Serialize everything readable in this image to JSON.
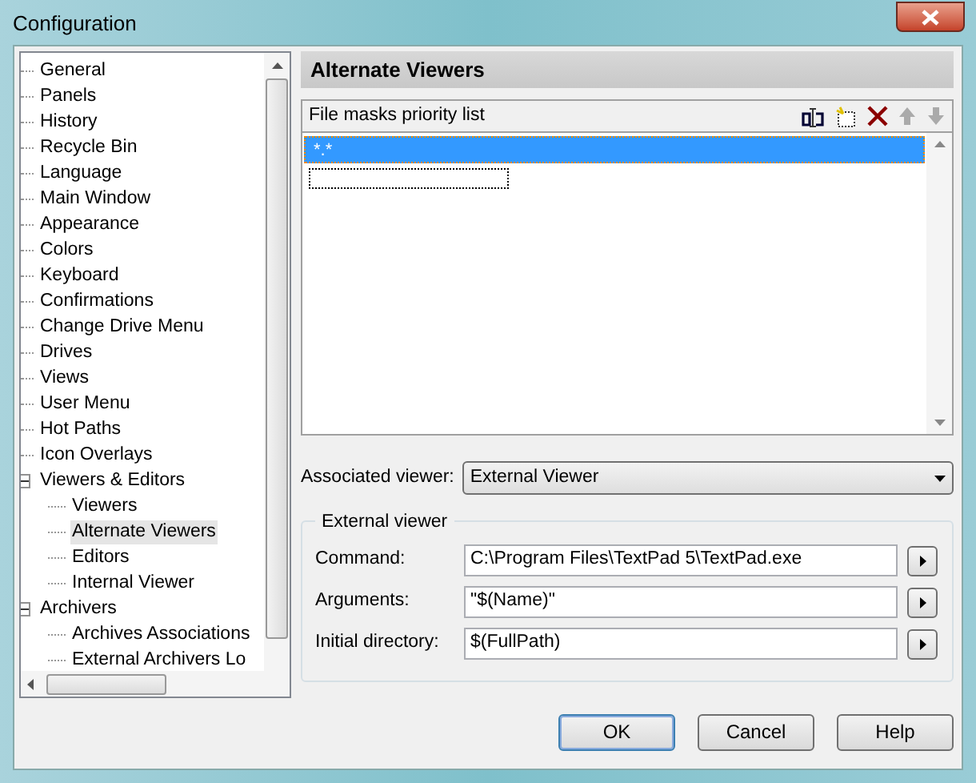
{
  "window": {
    "title": "Configuration"
  },
  "tree": [
    {
      "label": "General",
      "selected": false
    },
    {
      "label": "Panels",
      "selected": false
    },
    {
      "label": "History",
      "selected": false
    },
    {
      "label": "Recycle Bin",
      "selected": false
    },
    {
      "label": "Language",
      "selected": false
    },
    {
      "label": "Main Window",
      "selected": false
    },
    {
      "label": "Appearance",
      "selected": false
    },
    {
      "label": "Colors",
      "selected": false
    },
    {
      "label": "Keyboard",
      "selected": false
    },
    {
      "label": "Confirmations",
      "selected": false
    },
    {
      "label": "Change Drive Menu",
      "selected": false
    },
    {
      "label": "Drives",
      "selected": false
    },
    {
      "label": "Views",
      "selected": false
    },
    {
      "label": "User Menu",
      "selected": false
    },
    {
      "label": "Hot Paths",
      "selected": false
    },
    {
      "label": "Icon Overlays",
      "selected": false
    },
    {
      "label": "Viewers & Editors",
      "selected": false,
      "expanded": true,
      "children": [
        {
          "label": "Viewers",
          "selected": false
        },
        {
          "label": "Alternate Viewers",
          "selected": true
        },
        {
          "label": "Editors",
          "selected": false
        },
        {
          "label": "Internal Viewer",
          "selected": false
        }
      ]
    },
    {
      "label": "Archivers",
      "selected": false,
      "expanded": true,
      "children": [
        {
          "label": "Archives Associations",
          "selected": false
        },
        {
          "label": "External Archivers Lo",
          "selected": false
        }
      ]
    }
  ],
  "page": {
    "title": "Alternate Viewers",
    "list": {
      "title": "File masks priority list",
      "items": [
        {
          "text": "*.*",
          "selected": true
        }
      ]
    },
    "associated_viewer": {
      "label": "Associated viewer:",
      "value": "External Viewer"
    },
    "group": {
      "title": "External viewer",
      "fields": [
        {
          "label": "Command:",
          "value": "C:\\Program Files\\TextPad 5\\TextPad.exe"
        },
        {
          "label": "Arguments:",
          "value": "\"$(Name)\""
        },
        {
          "label": "Initial directory:",
          "value": "$(FullPath)"
        }
      ]
    }
  },
  "buttons": [
    "OK",
    "Cancel",
    "Help"
  ]
}
